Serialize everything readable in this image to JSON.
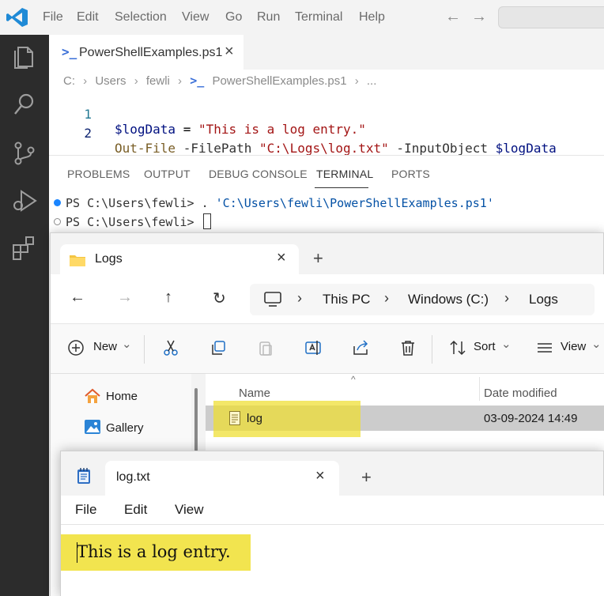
{
  "vscode": {
    "menu": [
      "File",
      "Edit",
      "Selection",
      "View",
      "Go",
      "Run",
      "Terminal",
      "Help"
    ],
    "tab": {
      "label": "PowerShellExamples.ps1",
      "close": "×"
    },
    "breadcrumb": [
      "C:",
      "Users",
      "fewli",
      "PowerShellExamples.ps1",
      "..."
    ],
    "code": {
      "line_numbers": [
        "1",
        "2"
      ],
      "line1": {
        "var": "$logData",
        "op": " = ",
        "str": "\"This is a log entry.\""
      },
      "line2": {
        "cmd": "Out-File",
        "p1": " -FilePath ",
        "str": "\"C:\\Logs\\log.txt\"",
        "p2": " -InputObject ",
        "var": "$logData"
      }
    },
    "panel_tabs": [
      "PROBLEMS",
      "OUTPUT",
      "DEBUG CONSOLE",
      "TERMINAL",
      "PORTS"
    ],
    "terminal": {
      "line1_prompt": "PS C:\\Users\\fewli> . ",
      "line1_path": "'C:\\Users\\fewli\\PowerShellExamples.ps1'",
      "line2_prompt": "PS C:\\Users\\fewli> "
    },
    "colors": {
      "accent": "#1a85ff",
      "activitybar": "#2c2c2c",
      "string": "#a31515",
      "variable": "#001080",
      "command": "#795e26"
    }
  },
  "explorer": {
    "tab": {
      "label": "Logs",
      "close": "×"
    },
    "new_tab": "+",
    "address": [
      "This PC",
      "Windows (C:)",
      "Logs"
    ],
    "toolbar": {
      "new": "New",
      "sort": "Sort",
      "view": "View",
      "caret": "⌄"
    },
    "sidebar": [
      {
        "label": "Home",
        "icon": "home-icon"
      },
      {
        "label": "Gallery",
        "icon": "gallery-icon"
      }
    ],
    "columns": {
      "name": "Name",
      "date": "Date modified"
    },
    "files": [
      {
        "name": "log",
        "date": "03-09-2024 14:49"
      }
    ],
    "highlight_color": "#eede2e"
  },
  "notepad": {
    "tab": {
      "label": "log.txt",
      "close": "×"
    },
    "new_tab": "+",
    "menu": [
      "File",
      "Edit",
      "View"
    ],
    "content": "This is a log entry.",
    "highlight_color": "#f0df30"
  }
}
